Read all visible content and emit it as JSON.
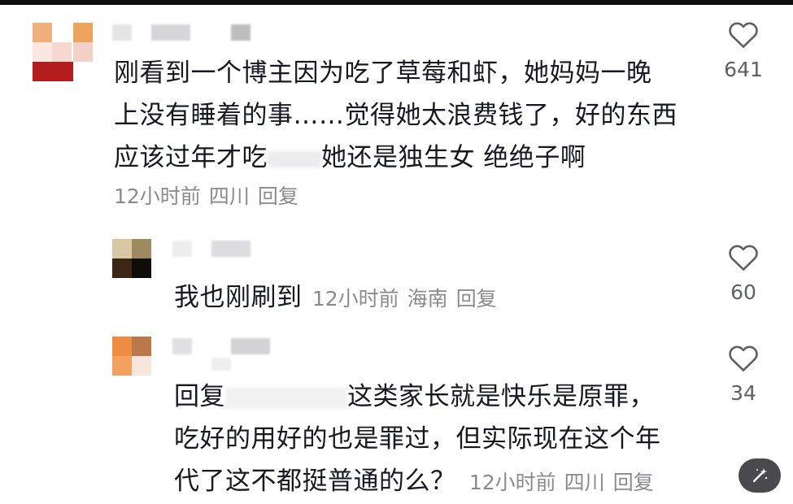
{
  "comments": [
    {
      "text_lines": [
        "刚看到一个博主因为吃了草莓和虾，她妈妈一晚",
        "上没有睡着的事……觉得她太浪费钱了，好的东西",
        "应该过年才吃",
        "她还是独生女 绝绝子啊"
      ],
      "time": "12小时前",
      "location": "四川",
      "reply_label": "回复",
      "likes": "641"
    },
    {
      "text": "我也刚刷到",
      "time": "12小时前",
      "location": "海南",
      "reply_label": "回复",
      "likes": "60"
    },
    {
      "reply_prefix": "回复",
      "text_lines": [
        "这类家长就是快乐是原罪，",
        "吃好的用好的也是罪过，但实际现在这个年",
        "代了这不都挺普通的么？"
      ],
      "time": "12小时前",
      "location": "四川",
      "reply_label": "回复",
      "likes": "34"
    }
  ],
  "colors": {
    "text": "#161823",
    "meta": "#8a8b91",
    "count": "#5e6068"
  },
  "icons": {
    "like": "heart-outline-icon",
    "floating": "magic-wand-icon"
  }
}
